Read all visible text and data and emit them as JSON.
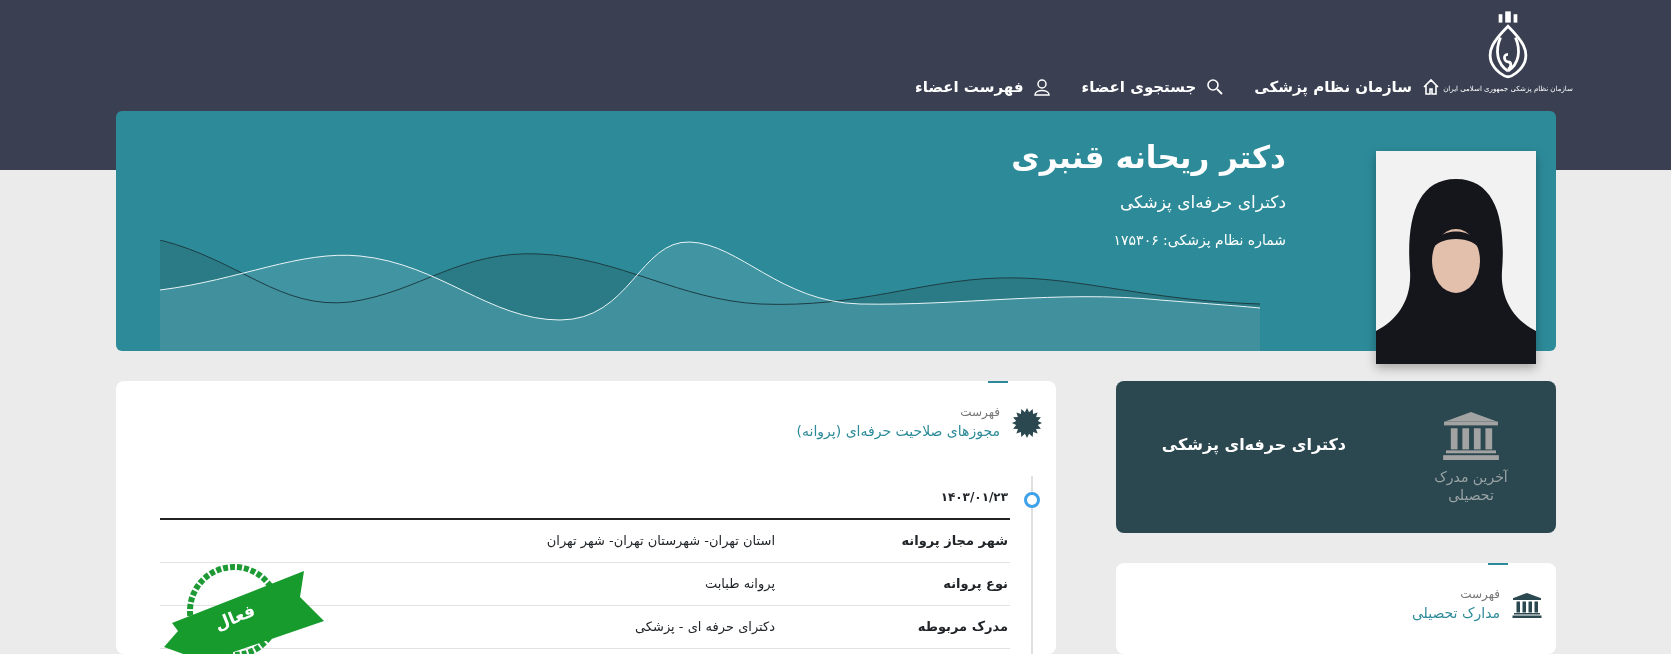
{
  "header": {
    "logo_caption": "سازمان نظام پزشکی جمهوری اسلامی ایران",
    "nav": [
      {
        "label": "سازمان نظام پزشکی",
        "kind": "home"
      },
      {
        "label": "جستجوی اعضاء",
        "kind": "search"
      },
      {
        "label": "فهرست اعضاء",
        "kind": "user"
      }
    ]
  },
  "profile": {
    "name": "دکتر ریحانه قنبری",
    "degree": "دکترای حرفه‌ای پزشکی",
    "number": "شماره نظام پزشکی: ۱۷۵۳۰۶"
  },
  "latest_degree": {
    "caption": "آخرین مدرک تحصیلی",
    "title": "دکترای حرفه‌ای پزشکی"
  },
  "licenses": {
    "kicker": "فهرست",
    "title": "مجوزهای صلاحیت حرفه‌ای (پروانه)",
    "entries": [
      {
        "date": "۱۴۰۳/۰۱/۲۳",
        "stamp": "فعال",
        "rows": [
          {
            "label": "شهر مجاز پروانه",
            "value": "استان تهران- شهرستان تهران- شهر تهران"
          },
          {
            "label": "نوع پروانه",
            "value": "پروانه طبابت"
          },
          {
            "label": "مدرک مربوطه",
            "value": "دکترای حرفه ای - پزشکی"
          }
        ]
      }
    ]
  },
  "education": {
    "kicker": "فهرست",
    "title": "مدارک تحصیلی"
  }
}
